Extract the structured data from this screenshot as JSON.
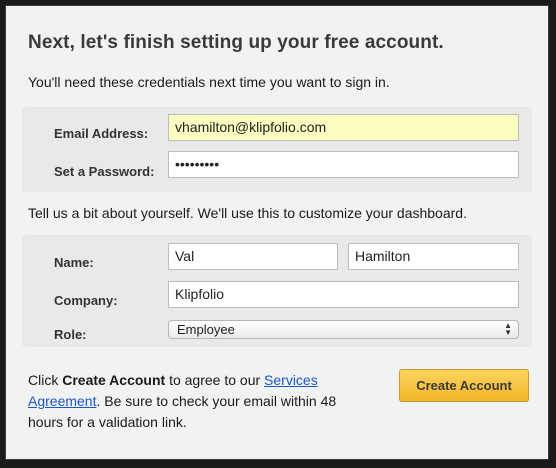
{
  "title": "Next, let's finish setting up your free account.",
  "credentials_intro": "You'll need these credentials next time you want to sign in.",
  "credentials": {
    "email_label": "Email Address:",
    "email_value": "vhamilton@klipfolio.com",
    "password_label": "Set a Password:",
    "password_value": "•••••••••"
  },
  "about_intro": "Tell us a bit about yourself. We'll use this to customize your dashboard.",
  "about": {
    "name_label": "Name:",
    "first_name": "Val",
    "last_name": "Hamilton",
    "company_label": "Company:",
    "company_value": "Klipfolio",
    "role_label": "Role:",
    "role_value": "Employee"
  },
  "footer": {
    "text_1": "Click ",
    "create_bold": "Create Account",
    "text_2": " to agree to our ",
    "link": "Services Agreement",
    "text_3": ". Be sure to check your email within 48 hours for a validation link."
  },
  "create_button": "Create Account"
}
